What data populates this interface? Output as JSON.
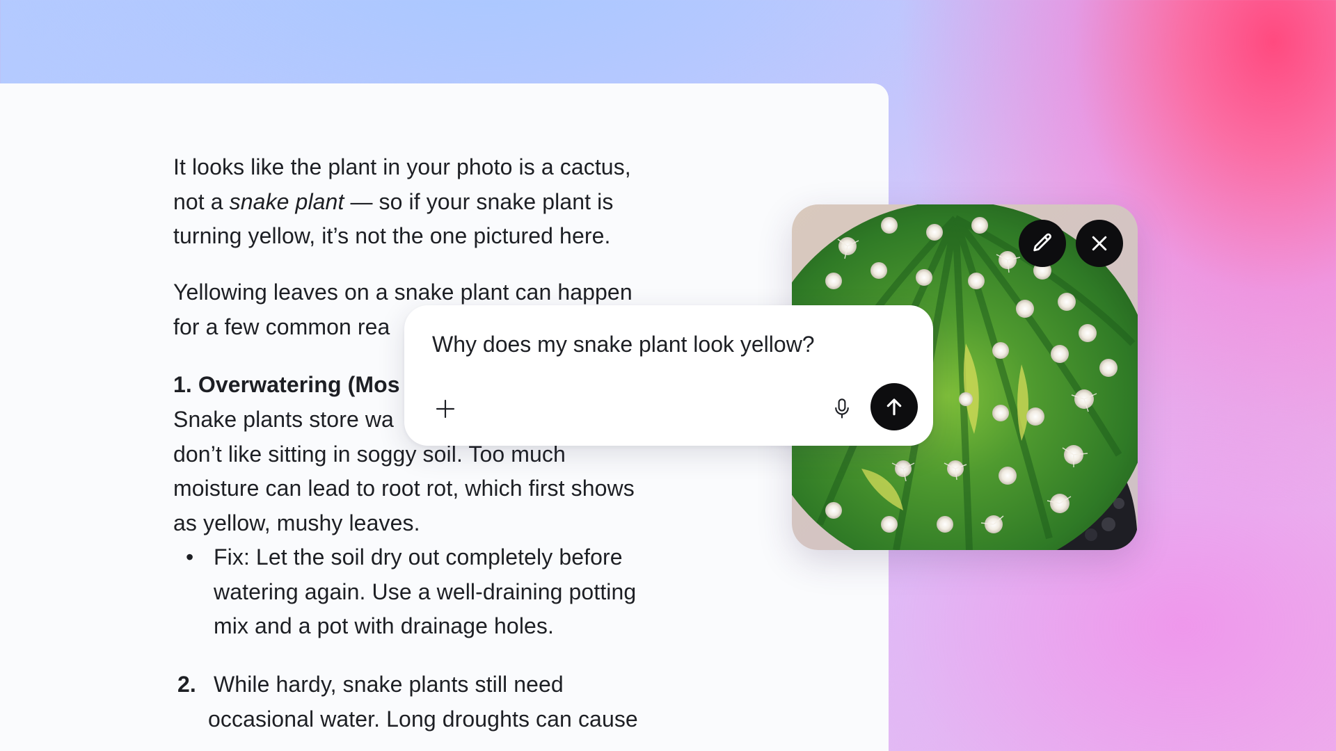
{
  "response": {
    "para1_a": "It looks like the plant in your photo is a cactus,",
    "para1_b_pre": "not a ",
    "para1_b_em": "snake plant",
    "para1_b_post": " — so if your snake plant is",
    "para1_c": "turning yellow, it’s not the one pictured here.",
    "para2_a": "Yellowing leaves on a snake plant can happen",
    "para2_b": "for a few common rea",
    "heading1": "1. Overwatering (Mos",
    "para3_a": "Snake plants store wa",
    "para3_b": "don’t like sitting in soggy soil. Too much",
    "para3_c": "moisture can lead to root rot, which first shows",
    "para3_d": "as yellow, mushy leaves.",
    "bullet_marker": "•",
    "bullet_a": "Fix: Let the soil dry out completely before",
    "bullet_b": "watering again. Use a well-draining potting",
    "bullet_c": "mix and a pot with drainage holes.",
    "item2_number": "2.",
    "item2_a": "While hardy, snake plants still need",
    "item2_b": "occasional water. Long droughts can cause"
  },
  "image_card": {
    "image_subject": "cactus",
    "edit_icon": "pencil-icon",
    "close_icon": "close-icon"
  },
  "prompt": {
    "text": "Why does my snake plant look yellow?",
    "add_icon": "plus-icon",
    "mic_icon": "microphone-icon",
    "send_icon": "arrow-up-icon"
  },
  "colors": {
    "text": "#1d1f24",
    "button_bg": "#0d0d0f",
    "panel_bg": "#fafbfd",
    "cactus_green": "#3d8a2c"
  }
}
